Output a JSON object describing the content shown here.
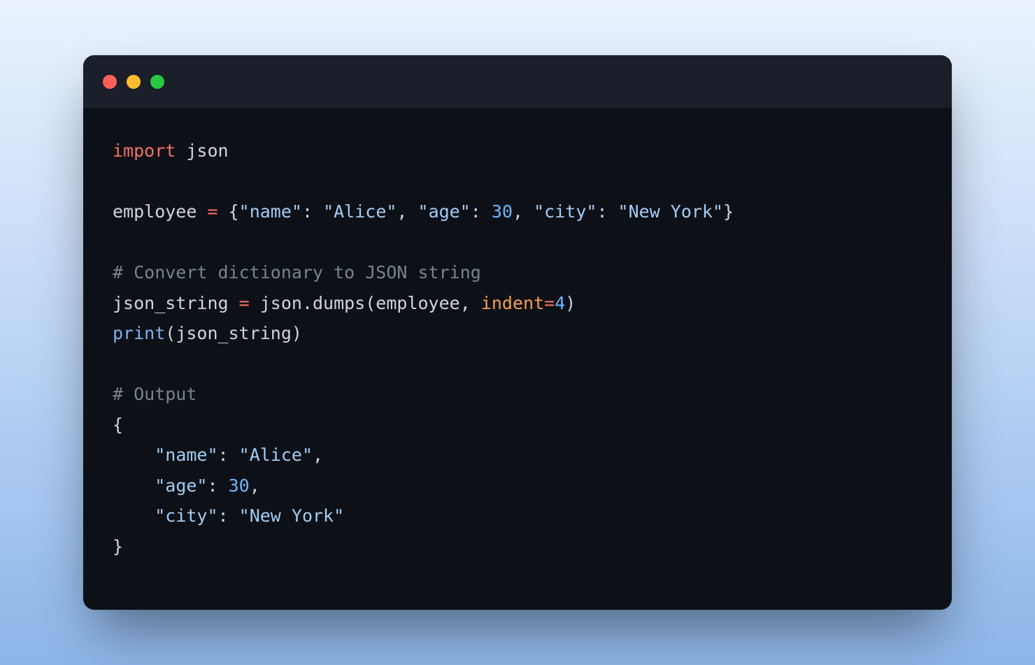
{
  "code": {
    "l1_kw": "import",
    "l1_mod": " json",
    "l3_a": "employee ",
    "l3_op": "=",
    "l3_b": " {",
    "l3_s1": "\"name\"",
    "l3_c": ": ",
    "l3_s2": "\"Alice\"",
    "l3_d": ", ",
    "l3_s3": "\"age\"",
    "l3_e": ": ",
    "l3_n1": "30",
    "l3_f": ", ",
    "l3_s4": "\"city\"",
    "l3_g": ": ",
    "l3_s5": "\"New York\"",
    "l3_h": "}",
    "l5_cmt": "# Convert dictionary to JSON string",
    "l6_a": "json_string ",
    "l6_op": "=",
    "l6_b": " json.dumps(employee, ",
    "l6_param": "indent",
    "l6_eq": "=",
    "l6_n": "4",
    "l6_c": ")",
    "l7_fn": "print",
    "l7_a": "(json_string)",
    "l9_cmt": "# Output",
    "l10": "{",
    "l11_a": "    ",
    "l11_s1": "\"name\"",
    "l11_b": ": ",
    "l11_s2": "\"Alice\"",
    "l11_c": ",",
    "l12_a": "    ",
    "l12_s1": "\"age\"",
    "l12_b": ": ",
    "l12_n": "30",
    "l12_c": ",",
    "l13_a": "    ",
    "l13_s1": "\"city\"",
    "l13_b": ": ",
    "l13_s2": "\"New York\"",
    "l14": "}"
  }
}
